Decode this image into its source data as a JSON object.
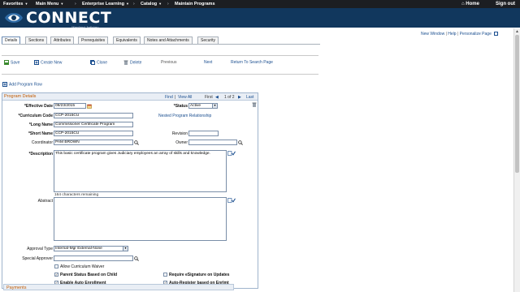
{
  "topnav": {
    "items": [
      "Favorites",
      "Main Menu",
      "Enterprise Learning",
      "Catalog",
      "Maintain Programs"
    ],
    "home": "Home",
    "signout": "Sign out"
  },
  "banner": {
    "logo_text": "CONNECT",
    "logo_subtitle": "Maryland Judiciary"
  },
  "toplinks": {
    "new_window": "New Window",
    "help": "Help",
    "personalize": "Personalize Page"
  },
  "tabs": [
    "Details",
    "Sections",
    "Attributes",
    "Prerequisites",
    "Equivalents",
    "Notes and Attachments",
    "Security"
  ],
  "toolbar": {
    "save": "Save",
    "create_new": "Create New",
    "clone": "Clone",
    "delete": "Delete",
    "previous": "Previous",
    "next": "Next",
    "return": "Return To Search Page"
  },
  "add_program_row": "Add Program Row",
  "program_details": {
    "title": "Program Details",
    "find": "Find",
    "view_all": "View All",
    "first": "First",
    "pager": "1 of 2",
    "last": "Last",
    "effective_date_label": "*Effective Date",
    "effective_date": "09/23/2015",
    "status_label": "*Status",
    "status": "Active",
    "curriculum_code_label": "*Curriculum Code",
    "curriculum_code": "CCP-2015CU",
    "nested_link": "Nested Program Relationship",
    "long_name_label": "*Long Name",
    "long_name": "Commissioner Certificate Program",
    "short_name_label": "*Short Name",
    "short_name": "CCP-2015CU",
    "revision_label": "Revision",
    "revision": "",
    "coordinator_label": "Coordinator",
    "coordinator": "PAM BROWN",
    "owner_label": "Owner",
    "owner": "",
    "description_label": "*Description",
    "description": "This basic certificate program gives Judiciary employees an array of skills and knowledge.",
    "chars_remaining": "164 characters remaining",
    "abstract_label": "Abstract",
    "abstract": "",
    "approval_type_label": "Approval Type",
    "approval_type": "Internal-Mgr External-None",
    "special_approver_label": "Special Approver",
    "special_approver": "",
    "allow_waiver": {
      "label": "Allow Curriculum Waiver",
      "checked": false
    },
    "parent_status": {
      "label": "Parent Status Based on Child",
      "checked": true
    },
    "require_esig": {
      "label": "Require eSignature on Updates",
      "checked": false
    },
    "auto_enroll": {
      "label": "Enable Auto Enrollment",
      "checked": true
    },
    "auto_register": {
      "label": "Auto-Register based on Enrlmt",
      "checked": true
    }
  },
  "payments": {
    "title": "Payments"
  },
  "colors": {
    "nav_bg": "#1c1e22",
    "banner_bg": "#11375d",
    "link": "#1a4e8f",
    "panel_title": "#c05a00"
  }
}
